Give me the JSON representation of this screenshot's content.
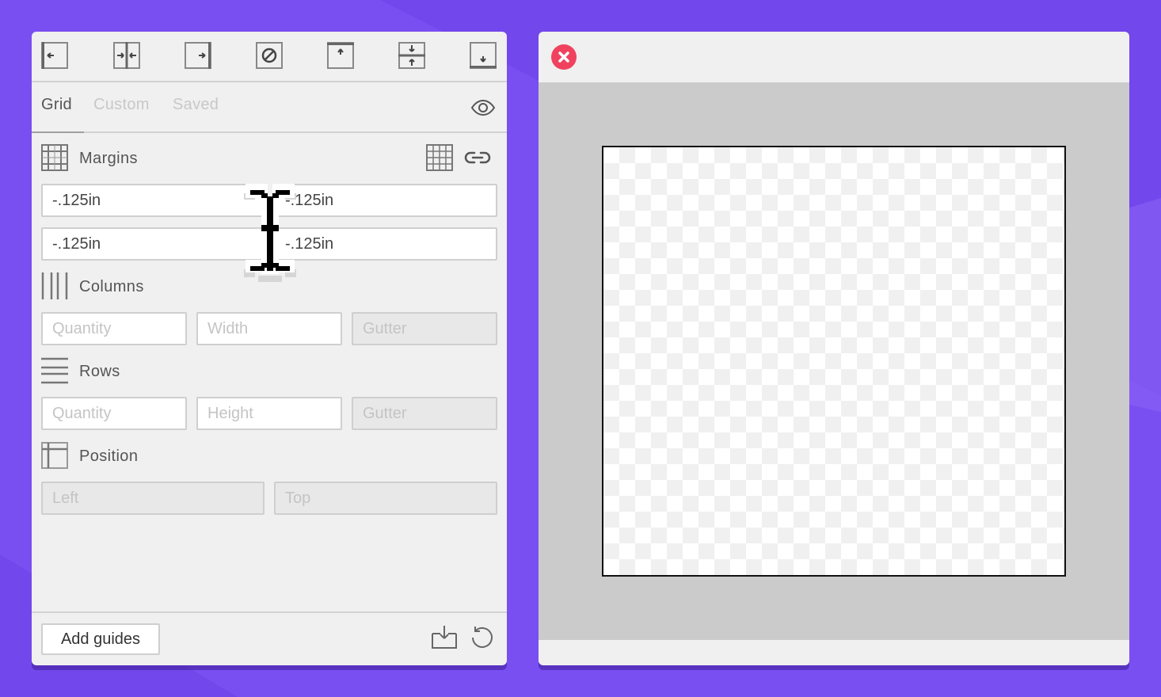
{
  "toolbar": {
    "icons": [
      "align-left-icon",
      "align-center-horizontal-icon",
      "align-right-icon",
      "clear-guides-icon",
      "align-top-icon",
      "align-middle-vertical-icon",
      "align-bottom-icon"
    ]
  },
  "tabs": [
    {
      "label": "Grid",
      "active": true
    },
    {
      "label": "Custom",
      "active": false
    },
    {
      "label": "Saved",
      "active": false
    }
  ],
  "margins": {
    "label": "Margins",
    "top": "-.125in",
    "right": "-.125in",
    "bottom": "-.125in",
    "left": "-.125in"
  },
  "columns": {
    "label": "Columns",
    "quantity_placeholder": "Quantity",
    "width_placeholder": "Width",
    "gutter_placeholder": "Gutter"
  },
  "rows": {
    "label": "Rows",
    "quantity_placeholder": "Quantity",
    "height_placeholder": "Height",
    "gutter_placeholder": "Gutter"
  },
  "position": {
    "label": "Position",
    "left_placeholder": "Left",
    "top_placeholder": "Top"
  },
  "footer": {
    "add_guides_label": "Add guides"
  },
  "colors": {
    "background": "#7a4ff2",
    "panel": "#f0f0f0",
    "close_button": "#f0425e",
    "stage": "#cbcbcb"
  }
}
